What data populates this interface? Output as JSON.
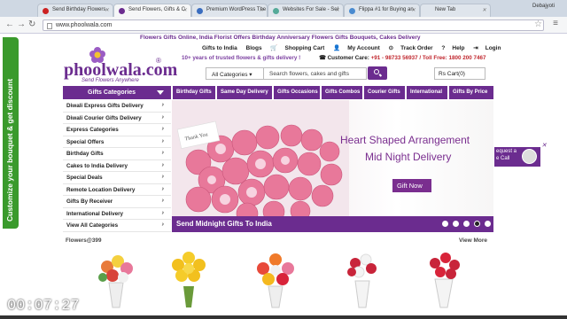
{
  "browser": {
    "tabs": [
      {
        "label": "Send Birthday Flowers"
      },
      {
        "label": "Send Flowers, Gifts & C"
      },
      {
        "label": "Premium WordPress The"
      },
      {
        "label": "Websites For Sale - Sel"
      },
      {
        "label": "Flippa #1 for Buying an"
      },
      {
        "label": "New Tab"
      }
    ],
    "user": "Debajyoti",
    "url": "www.phoolwala.com",
    "back_icon": "back-arrow-icon",
    "forward_icon": "forward-arrow-icon",
    "reload_icon": "reload-icon"
  },
  "sidetab": {
    "label": "Customize your bouquet & get discount"
  },
  "header": {
    "tagline": "Flowers Gifts Online, India Florist Offers Birthday Anniversary Flowers Gifts Bouquets, Cakes Delivery",
    "logo_text": "phoolwala.com",
    "logo_reg": "®",
    "logo_tagline": "Send Flowers Anywhere",
    "top_links": [
      "Gifts to India",
      "Blogs",
      "Shopping Cart",
      "My Account",
      "Track Order",
      "Help",
      "Login"
    ],
    "promo": "10+ years of trusted flowers & gifts delivery !",
    "care_label": "Customer Care:",
    "care_numbers": "+91 - 98733 56937 / Toll Free: 1800 200 7467",
    "category_select": "All Categories",
    "search_placeholder": "Search flowers, cakes and gifts",
    "cart_value": "Rs Cart(0)"
  },
  "nav": {
    "categories_label": "Gifts Categories",
    "main_items": [
      "Birthday Gifts",
      "Same Day Delivery",
      "Gifts Occasions",
      "Gifts Combos",
      "Courier Gifts",
      "International",
      "Gifts By Price"
    ],
    "left_menu": [
      "Diwali Express Gifts Delivery",
      "Diwali Courier Gifts Delivery",
      "Express Categories",
      "Special Offers",
      "Birthday Gifts",
      "Cakes to India Delivery",
      "Special Deals",
      "Remote Location Delivery",
      "Gifts By Receiver",
      "International Delivery",
      "View All Categories"
    ]
  },
  "banner": {
    "card_text": "Thank You",
    "headline_1": "Heart Shaped Arrangement",
    "headline_2": "Mid Night Delivery",
    "button": "Gift Now",
    "strip": "Send Midnight Gifts To India",
    "slide_count": 5,
    "active_slide": 4,
    "colors": {
      "accent": "#6b2c8f",
      "rose": "#e8789a"
    }
  },
  "request_call": {
    "line1": "equest a",
    "line2": "e Call"
  },
  "products": {
    "section_title": "Flowers@399",
    "view_more": "View More",
    "items": [
      "mixed-bouquet",
      "yellow-roses",
      "gerbera-bouquet",
      "red-white-roses",
      "red-roses-wrap"
    ]
  },
  "video": {
    "timestamp": "00:07:27"
  }
}
